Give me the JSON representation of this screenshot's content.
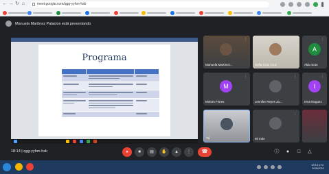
{
  "browser": {
    "url": "meet.google.com/qgg-yyhm-hsb",
    "back_icon": "arrow-left",
    "forward_icon": "arrow-right",
    "reload_icon": "reload",
    "home_icon": "home"
  },
  "meet": {
    "presenting_banner": "Manuela Martínez Palacios está presentando",
    "meeting_time": "18:14",
    "meeting_code": "qgg-yyhm-hsb"
  },
  "slide": {
    "title": "Programa"
  },
  "participants": [
    {
      "name": "Manuela Martínez...",
      "avatar_letter": ""
    },
    {
      "name": "Sofía Cruz Cruz",
      "avatar_letter": ""
    },
    {
      "name": "Aldo Soto",
      "avatar_letter": "A",
      "color": "#1e8e3e"
    },
    {
      "name": "Mirtom Flores",
      "avatar_letter": "M",
      "color": "#a142f4"
    },
    {
      "name": "Jennifer Reyes Zu...",
      "avatar_letter": ""
    },
    {
      "name": "Irma Noguez",
      "avatar_letter": "I",
      "color": "#a142f4"
    },
    {
      "name": "Tú",
      "avatar_letter": ""
    },
    {
      "name": "Mi más",
      "avatar_letter": ""
    },
    {
      "name": "",
      "avatar_letter": ""
    }
  ],
  "controls": {
    "mic_icon": "mic-off",
    "camera_icon": "camera",
    "captions_icon": "captions",
    "raise_hand_icon": "hand",
    "present_icon": "present",
    "more_icon": "more-vertical",
    "end_call_icon": "phone-hangup"
  },
  "taskbar": {
    "time": "18:14 p.m.",
    "date": "2/05/2021"
  },
  "colors": {
    "meet_bg": "#202124",
    "danger": "#ea4335",
    "slide_header": "#4472c4"
  }
}
